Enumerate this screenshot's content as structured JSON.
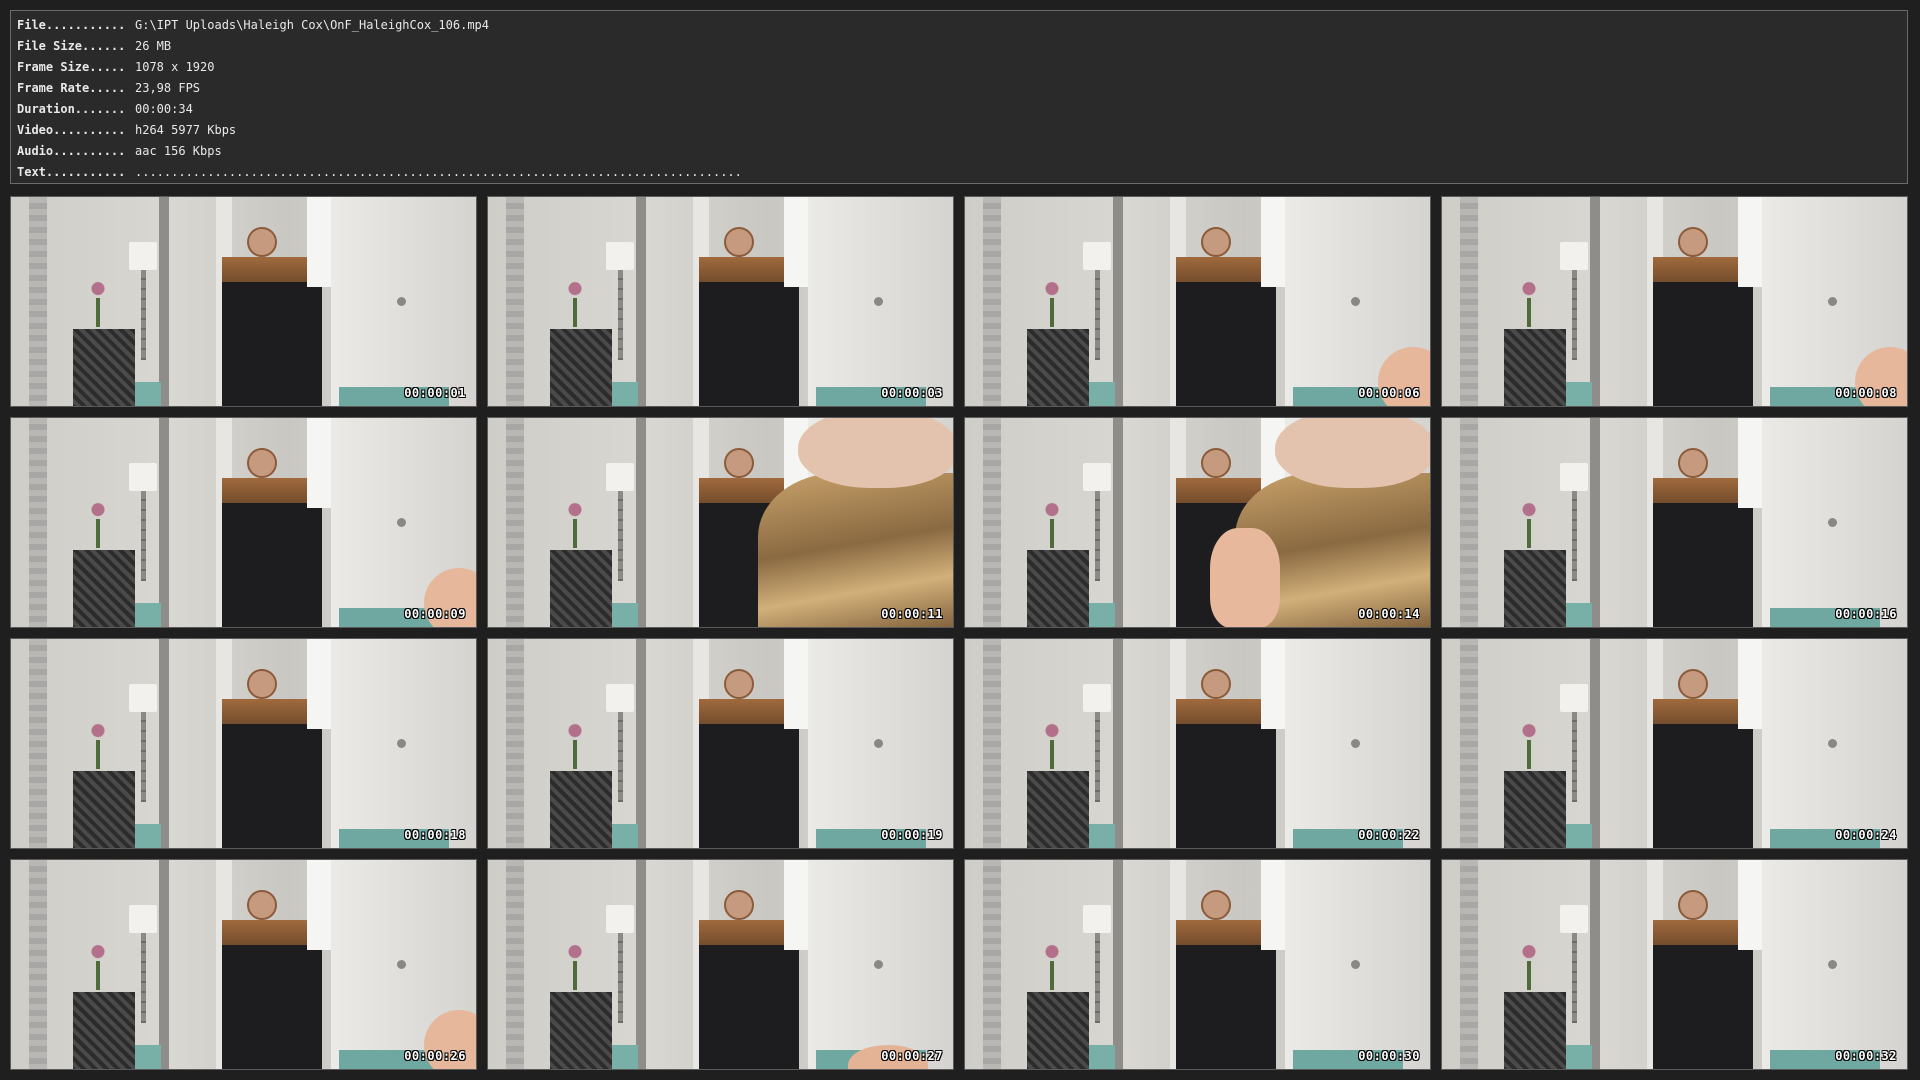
{
  "info": {
    "rows": [
      {
        "label": "File...........",
        "value": "G:\\IPT Uploads\\Haleigh Cox\\OnF_HaleighCox_106.mp4"
      },
      {
        "label": "File Size......",
        "value": "26 MB"
      },
      {
        "label": "Frame Size.....",
        "value": "1078 x 1920"
      },
      {
        "label": "Frame Rate.....",
        "value": "23,98 FPS"
      },
      {
        "label": "Duration.......",
        "value": "00:00:34"
      },
      {
        "label": "Video..........",
        "value": "h264 5977 Kbps"
      },
      {
        "label": "Audio..........",
        "value": "aac 156 Kbps"
      },
      {
        "label": "Text...........",
        "value": "...................................................................................."
      }
    ]
  },
  "thumbnails": [
    {
      "timestamp": "00:00:01",
      "subject": "empty-room"
    },
    {
      "timestamp": "00:00:03",
      "subject": "empty-room"
    },
    {
      "timestamp": "00:00:06",
      "subject": "skin-corner"
    },
    {
      "timestamp": "00:00:08",
      "subject": "skin-corner"
    },
    {
      "timestamp": "00:00:09",
      "subject": "skin-corner"
    },
    {
      "timestamp": "00:00:11",
      "subject": "person-hat"
    },
    {
      "timestamp": "00:00:14",
      "subject": "person-hat-arm"
    },
    {
      "timestamp": "00:00:16",
      "subject": "empty-room"
    },
    {
      "timestamp": "00:00:18",
      "subject": "empty-room"
    },
    {
      "timestamp": "00:00:19",
      "subject": "empty-room"
    },
    {
      "timestamp": "00:00:22",
      "subject": "empty-room"
    },
    {
      "timestamp": "00:00:24",
      "subject": "empty-room"
    },
    {
      "timestamp": "00:00:26",
      "subject": "skin-corner"
    },
    {
      "timestamp": "00:00:27",
      "subject": "skin-bottom"
    },
    {
      "timestamp": "00:00:30",
      "subject": "empty-room"
    },
    {
      "timestamp": "00:00:32",
      "subject": "empty-room"
    }
  ]
}
